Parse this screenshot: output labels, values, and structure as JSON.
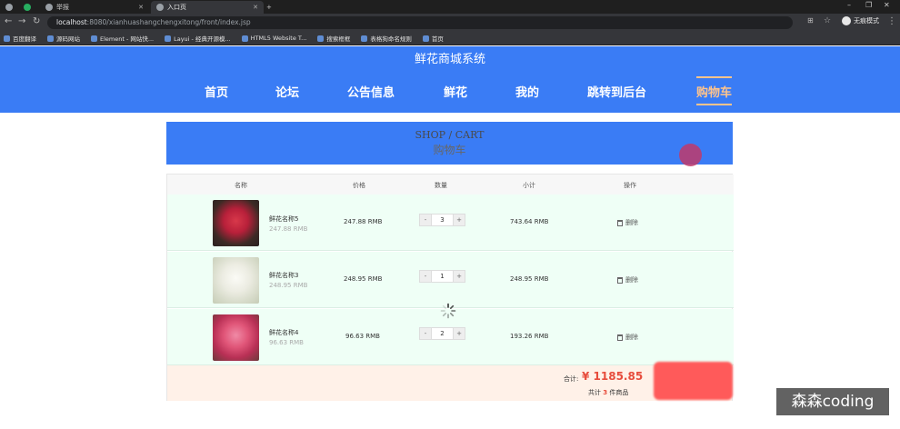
{
  "browser": {
    "tabs": [
      {
        "label": "",
        "active": false
      },
      {
        "label": "",
        "active": false
      },
      {
        "label": "举报",
        "active": false
      },
      {
        "label": "入口页",
        "active": true
      }
    ],
    "url_host": "localhost",
    "url_path": ":8080/xianhuashangchengxitong/front/index.jsp",
    "incognito_label": "无痕模式",
    "bookmarks": [
      "百度翻译",
      "源码网站",
      "Element - 网站快...",
      "Layui - 经典开源模...",
      "HTML5 Website T...",
      "搜索框框",
      "表格狗命名规则",
      "首页"
    ]
  },
  "site": {
    "title": "鲜花商城系统",
    "nav": [
      "首页",
      "论坛",
      "公告信息",
      "鲜花",
      "我的",
      "跳转到后台",
      "购物车"
    ],
    "active_nav": "购物车"
  },
  "cart": {
    "banner_en": "SHOP / CART",
    "banner_cn": "购物车",
    "columns": [
      "名称",
      "价格",
      "数量",
      "小计",
      "操作"
    ],
    "items": [
      {
        "name": "鲜花名称5",
        "sub_price": "247.88 RMB",
        "price": "247.88 RMB",
        "qty": "3",
        "subtotal": "743.64 RMB",
        "action": "删除",
        "minus": "-",
        "plus": "+"
      },
      {
        "name": "鲜花名称3",
        "sub_price": "248.95 RMB",
        "price": "248.95 RMB",
        "qty": "1",
        "subtotal": "248.95 RMB",
        "action": "删除",
        "minus": "-",
        "plus": "+"
      },
      {
        "name": "鲜花名称4",
        "sub_price": "96.63 RMB",
        "price": "96.63 RMB",
        "qty": "2",
        "subtotal": "193.26 RMB",
        "action": "删除",
        "minus": "-",
        "plus": "+"
      }
    ],
    "total_label": "合计:",
    "total_amount": "¥ 1185.85",
    "count_prefix": "共计",
    "count_value": "3",
    "count_suffix": "件商品"
  },
  "watermark": "森森coding",
  "colors": {
    "header_blue": "#3a7cf5",
    "accent_orange": "#ffc48c",
    "price_red": "#e74c3c",
    "row_green": "#effff6"
  }
}
